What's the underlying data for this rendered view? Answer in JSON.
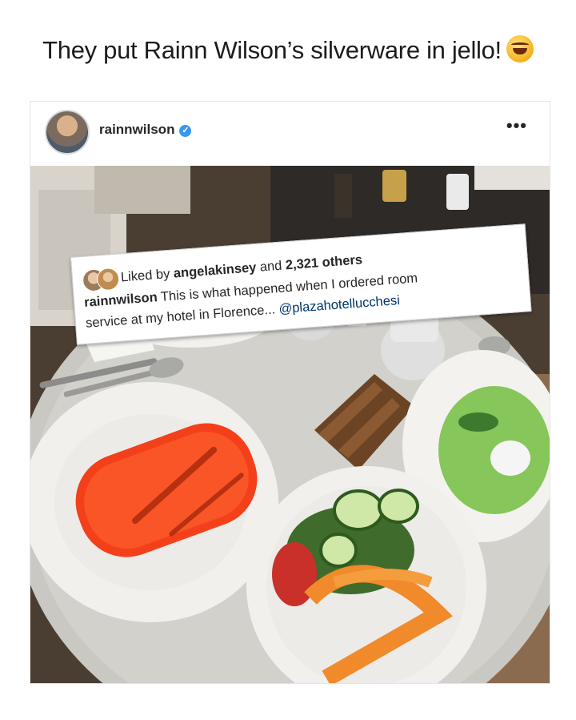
{
  "caption": {
    "text": "They put Rainn Wilson’s silverware in jello!",
    "emoji": "rolling-on-floor-laughing-icon"
  },
  "post": {
    "username": "rainnwilson",
    "verified_icon": "verified-badge-icon",
    "more_icon": "more-options-icon",
    "likes": {
      "prefix": "Liked by",
      "first_liker": "angelakinsey",
      "joiner": "and",
      "others": "2,321 others"
    },
    "comment": {
      "author": "rainnwilson",
      "text_line1": "This is what happened when I ordered room",
      "text_line2": "service at my hotel in Florence...",
      "mention": "@plazahotellucchesi"
    }
  },
  "photo": {
    "description_items": [
      "jello-plate",
      "salad-plate",
      "soup-plate",
      "bread",
      "pasta-plate",
      "water-glasses",
      "spoon"
    ]
  }
}
